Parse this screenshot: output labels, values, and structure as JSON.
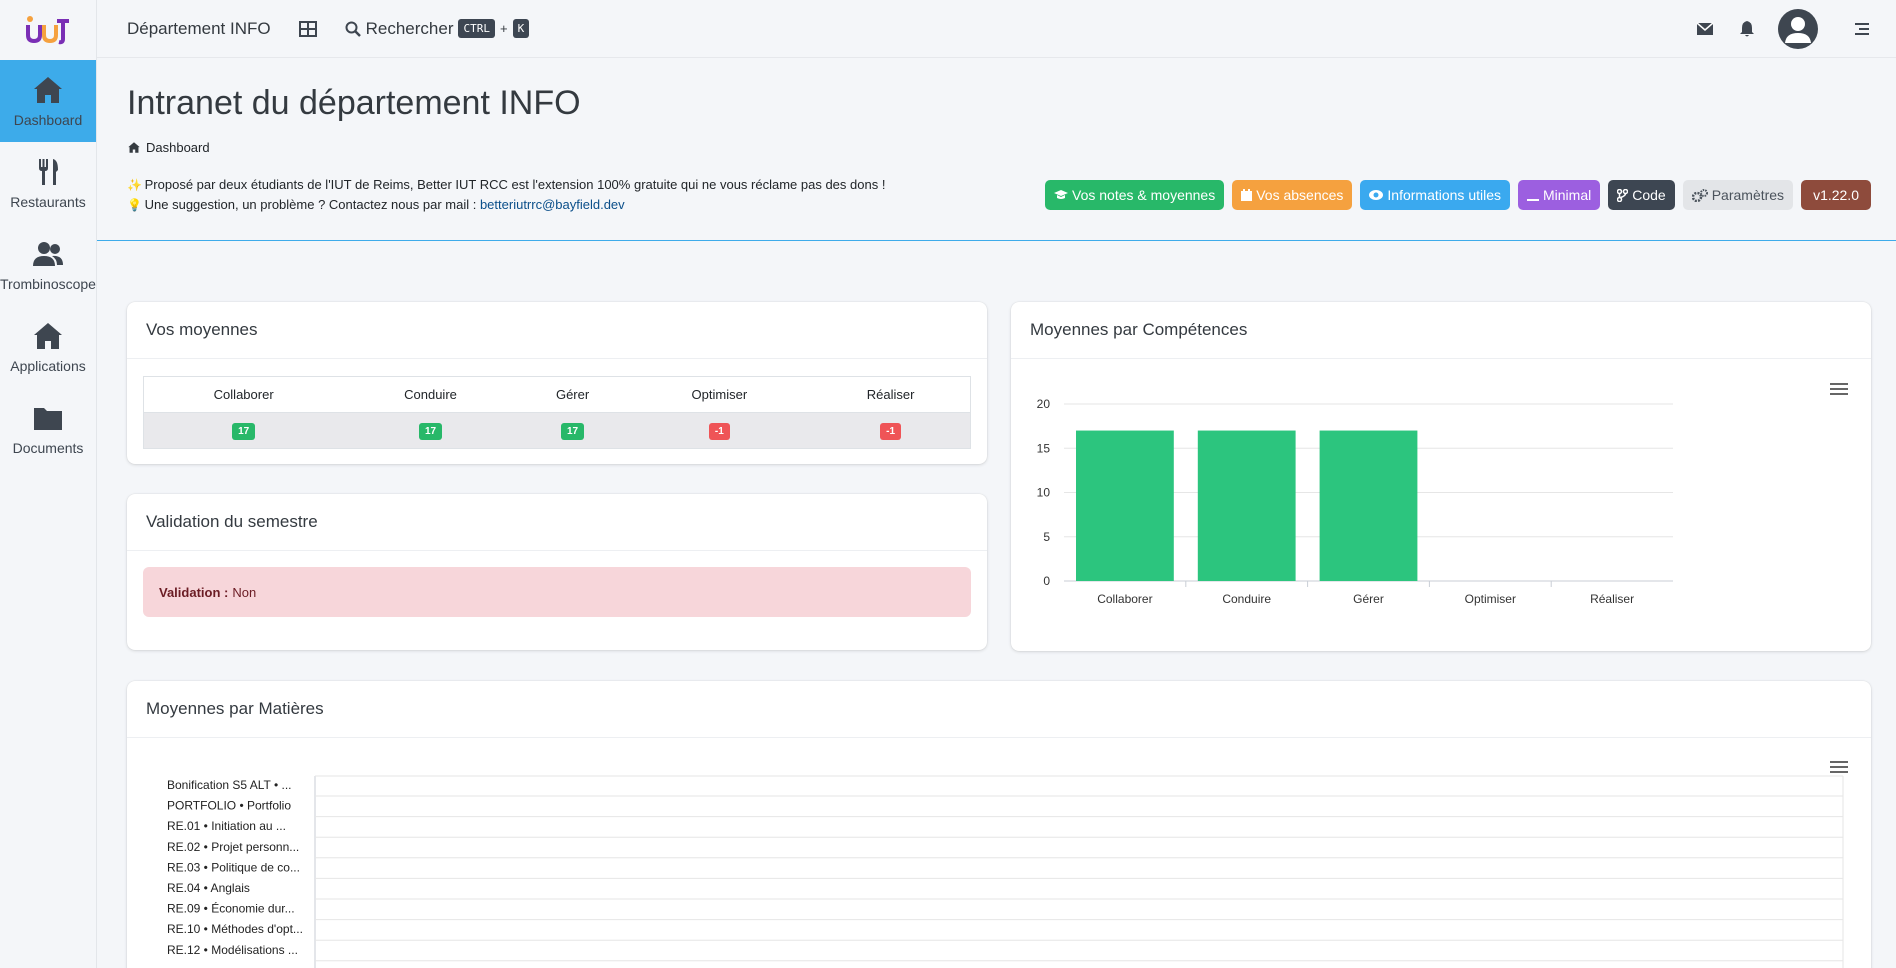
{
  "sidebar": {
    "items": [
      {
        "label": "Dashboard",
        "icon": "home-icon",
        "active": true
      },
      {
        "label": "Restaurants",
        "icon": "utensils-icon"
      },
      {
        "label": "Trombinoscope",
        "icon": "users-icon"
      },
      {
        "label": "Applications",
        "icon": "home-icon"
      },
      {
        "label": "Documents",
        "icon": "folder-icon"
      }
    ]
  },
  "topbar": {
    "title": "Département INFO",
    "search_label": "Rechercher",
    "kbd_ctrl": "CTRL",
    "kbd_plus": "+",
    "kbd_k": "K"
  },
  "header": {
    "title": "Intranet du département INFO",
    "breadcrumb": "Dashboard",
    "line1_emoji": "✨",
    "line1": "Proposé par deux étudiants de l'IUT de Reims, Better IUT RCC est l'extension 100% gratuite qui ne vous réclame pas des dons !",
    "line2_emoji": "💡",
    "line2": "Une suggestion, un problème ? Contactez nous par mail :",
    "email": "betteriutrrc@bayfield.dev"
  },
  "buttons": [
    {
      "label": "Vos notes & moyennes",
      "color": "#28b869",
      "icon": "graduation-cap-icon"
    },
    {
      "label": "Vos absences",
      "color": "#f5a13f",
      "icon": "calendar-icon"
    },
    {
      "label": "Informations utiles",
      "color": "#3aa9ef",
      "icon": "eye-icon"
    },
    {
      "label": "Minimal",
      "color": "#9c5fe0",
      "icon": "minus-icon"
    },
    {
      "label": "Code",
      "color": "#3d4652",
      "icon": "code-branch-icon"
    },
    {
      "label": "Paramètres",
      "color": "#e3e5e8",
      "text_color": "#4b535c",
      "icon": "cogs-icon"
    },
    {
      "label": "v1.22.0",
      "color": "#8e4b3c",
      "icon": ""
    }
  ],
  "moyennes_card": {
    "title": "Vos moyennes",
    "headers": [
      "Collaborer",
      "Conduire",
      "Gérer",
      "Optimiser",
      "Réaliser"
    ],
    "values": [
      {
        "value": "17",
        "color": "#28b869"
      },
      {
        "value": "17",
        "color": "#28b869"
      },
      {
        "value": "17",
        "color": "#28b869"
      },
      {
        "value": "-1",
        "color": "#ef5457"
      },
      {
        "value": "-1",
        "color": "#ef5457"
      }
    ]
  },
  "validation_card": {
    "title": "Validation du semestre",
    "label": "Validation :",
    "value": "Non"
  },
  "competences_card": {
    "title": "Moyennes par Compétences"
  },
  "matieres_card": {
    "title": "Moyennes par Matières",
    "rows": [
      "Bonification S5 ALT • ...",
      "PORTFOLIO • Portfolio",
      "RE.01 • Initiation au ...",
      "RE.02 • Projet personn...",
      "RE.03 • Politique de co...",
      "RE.04 • Anglais",
      "RE.09 • Économie dur...",
      "RE.10 • Méthodes d'opt...",
      "RE.12 • Modélisations ..."
    ]
  },
  "chart_data": {
    "type": "bar",
    "title": "",
    "categories": [
      "Collaborer",
      "Conduire",
      "Gérer",
      "Optimiser",
      "Réaliser"
    ],
    "values": [
      17,
      17,
      17,
      -1,
      -1
    ],
    "ylim": [
      0,
      20
    ],
    "yticks": [
      0,
      5,
      10,
      15,
      20
    ],
    "grid": true,
    "color": "#2cc57e"
  }
}
